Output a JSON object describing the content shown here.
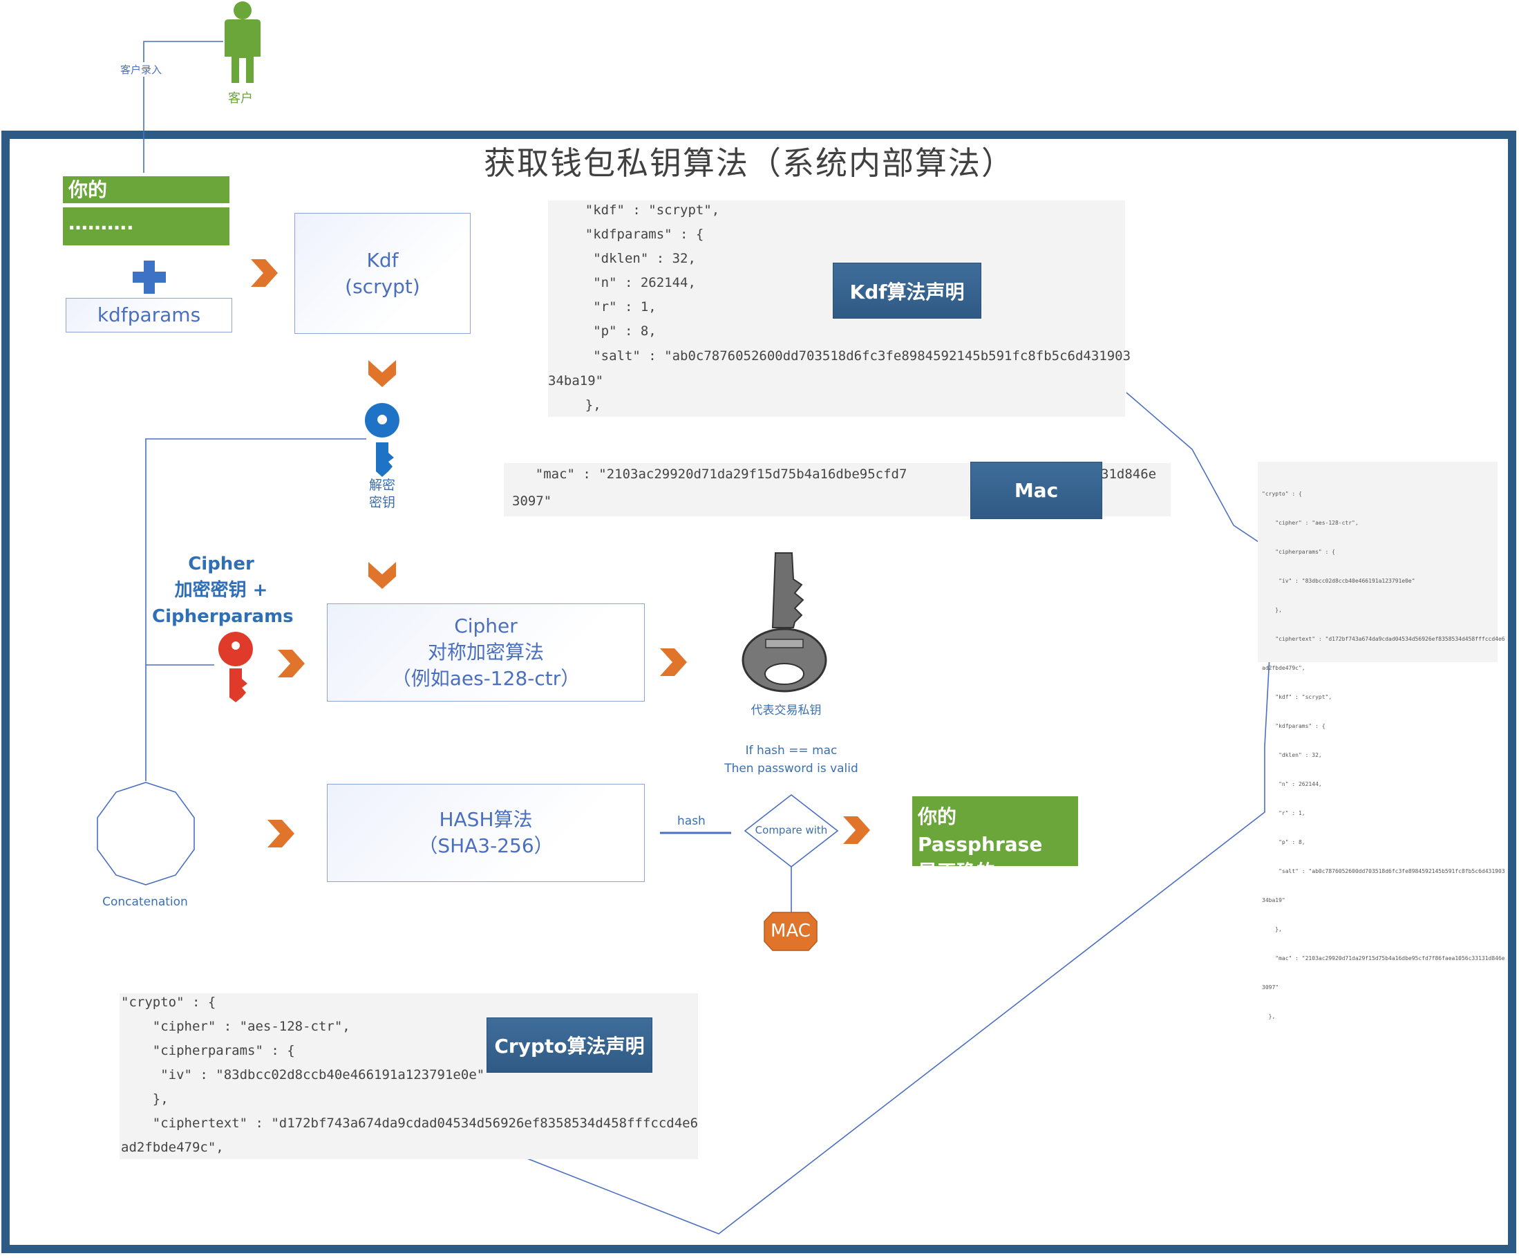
{
  "title": "获取钱包私钥算法（系统内部算法）",
  "customer": {
    "label": "客户",
    "entry_label": "客户录入"
  },
  "passphrase": {
    "title": "你的Passphrase",
    "mask": "………."
  },
  "kdfparams_label": "kdfparams",
  "kdf_box": {
    "line1": "Kdf",
    "line2": "(scrypt)"
  },
  "decrypt_key_label": {
    "line1": "解密",
    "line2": "密钥"
  },
  "cipher_key_label": {
    "line1": "Cipher",
    "line2": "加密密钥 +",
    "line3": "Cipherparams"
  },
  "cipher_box": {
    "line1": "Cipher",
    "line2": "对称加密算法",
    "line3": "（例如aes-128-ctr）"
  },
  "private_key_label": "代表交易私钥",
  "hash_box": {
    "line1": "HASH算法",
    "line2": "（SHA3-256）"
  },
  "concatenation_label": "Concatenation",
  "hash_label": "hash",
  "compare_label": "Compare with",
  "condition": {
    "line1": "If hash == mac",
    "line2": "Then password is valid"
  },
  "mac_badge": "MAC",
  "valid_box": {
    "line1": "你的Passphrase",
    "line2": "是正确的"
  },
  "kdf_code": {
    "lines": [
      "    \"kdf\" : \"scrypt\",",
      "    \"kdfparams\" : {",
      "     \"dklen\" : 32,",
      "     \"n\" : 262144,",
      "     \"r\" : 1,",
      "     \"p\" : 8,",
      "     \"salt\" : \"ab0c7876052600dd703518d6fc3fe8984592145b591fc8fb5c6d431903",
      "34ba19\"",
      "    },"
    ],
    "label": "Kdf算法声明"
  },
  "mac_code": {
    "lines": [
      "    \"mac\" : \"2103ac29920d71da29f15d75b4a16dbe95cfd7",
      "3097\""
    ],
    "tail": "31d846e",
    "label": "Mac"
  },
  "crypto_code": {
    "lines": [
      "\"crypto\" : {",
      "    \"cipher\" : \"aes-128-ctr\",",
      "    \"cipherparams\" : {",
      "     \"iv\" : \"83dbcc02d8ccb40e466191a123791e0e\"",
      "    },",
      "    \"ciphertext\" : \"d172bf743a674da9cdad04534d56926ef8358534d458fffccd4e6",
      "ad2fbde479c\","
    ],
    "label": "Crypto算法声明"
  },
  "full_code": {
    "lines": [
      "\"crypto\" : {",
      "    \"cipher\" : \"aes-128-ctr\",",
      "    \"cipherparams\" : {",
      "     \"iv\" : \"83dbcc02d8ccb40e466191a123791e0e\"",
      "    },",
      "    \"ciphertext\" : \"d172bf743a674da9cdad04534d56926ef8358534d458fffccd4e6",
      "ad2fbde479c\",",
      "    \"kdf\" : \"scrypt\",",
      "    \"kdfparams\" : {",
      "     \"dklen\" : 32,",
      "     \"n\" : 262144,",
      "     \"r\" : 1,",
      "     \"p\" : 8,",
      "     \"salt\" : \"ab0c7876052600dd703518d6fc3fe8984592145b591fc8fb5c6d431903",
      "34ba19\"",
      "    },",
      "    \"mac\" : \"2103ac29920d71da29f15d75b4a16dbe95cfd7f86faea1056c33131d846e",
      "3097\"",
      "  },"
    ]
  },
  "colors": {
    "frame": "#2d5b86",
    "green": "#6aa63a",
    "orange": "#e0742a",
    "blue_key": "#1f73c7",
    "red_key": "#e03a2b",
    "line": "#4a6fc0"
  }
}
